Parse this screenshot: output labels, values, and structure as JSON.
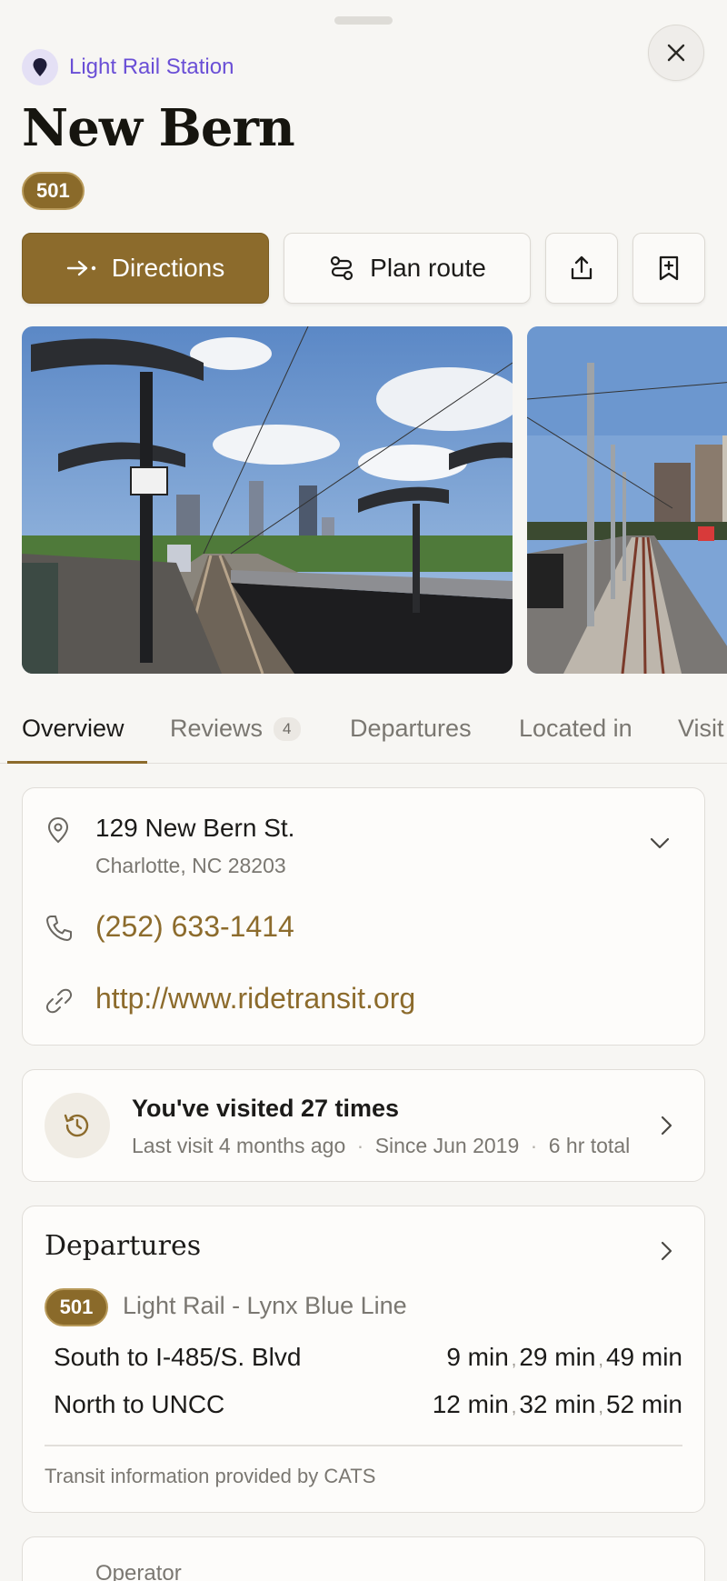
{
  "header": {
    "category": "Light Rail Station",
    "title": "New Bern",
    "route_badge": "501"
  },
  "actions": {
    "directions": "Directions",
    "plan_route": "Plan route"
  },
  "tabs": [
    {
      "label": "Overview"
    },
    {
      "label": "Reviews",
      "count": "4"
    },
    {
      "label": "Departures"
    },
    {
      "label": "Located in"
    },
    {
      "label": "Visit"
    }
  ],
  "contact": {
    "address_line1": "129 New Bern St.",
    "address_line2": "Charlotte, NC 28203",
    "phone": "(252) 633-1414",
    "website": "http://www.ridetransit.org"
  },
  "visits": {
    "title": "You've visited 27 times",
    "last_visit": "Last visit 4 months ago",
    "since": "Since Jun 2019",
    "total": "6 hr total"
  },
  "departures": {
    "title": "Departures",
    "route_badge": "501",
    "line_name": "Light Rail - Lynx Blue Line",
    "rows": [
      {
        "direction": "South to I-485/S. Blvd",
        "times": [
          "9 min",
          "29 min",
          "49 min"
        ]
      },
      {
        "direction": "North to UNCC",
        "times": [
          "12 min",
          "32 min",
          "52 min"
        ]
      }
    ],
    "footer": "Transit information provided by CATS"
  },
  "operator": {
    "label": "Operator"
  },
  "colors": {
    "accent": "#8c6b2c",
    "category": "#6a4fd6",
    "background": "#f7f6f3"
  }
}
